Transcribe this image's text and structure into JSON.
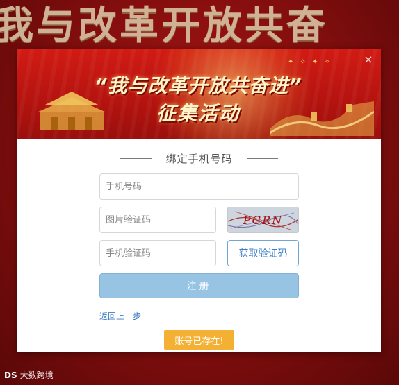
{
  "background": {
    "title": "我与改革开放共奋",
    "watermark": "大数跨境",
    "watermark_mark": "DS"
  },
  "banner": {
    "headline": "“我与改革开放共奋进”",
    "subheadline": "征集活动"
  },
  "modal": {
    "close_icon": "×",
    "form_title": "绑定手机号码",
    "phone_placeholder": "手机号码",
    "image_code_placeholder": "图片验证码",
    "captcha_text": "PGRN",
    "sms_code_placeholder": "手机验证码",
    "get_code_label": "获取验证码",
    "register_label": "注册",
    "back_label": "返回上一步",
    "toast": "账号已存在!"
  },
  "colors": {
    "accent": "#3b7dc4",
    "register_button": "#98c4e4",
    "toast": "#f3b032",
    "banner_red": "#c8170f"
  }
}
